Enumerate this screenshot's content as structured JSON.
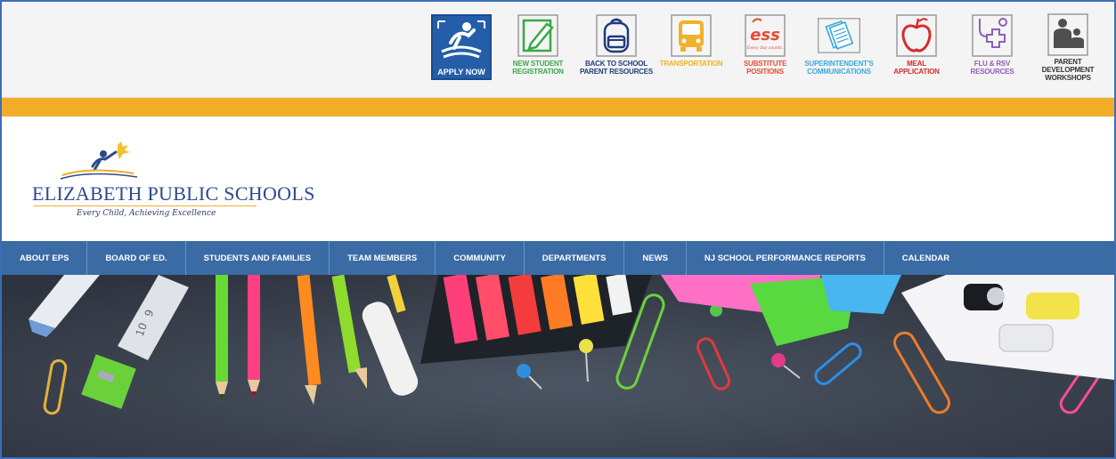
{
  "quick_links": [
    {
      "id": "apply",
      "label": "APPLY NOW",
      "icon": "student-reading-icon",
      "color": "#245ea8"
    },
    {
      "id": "registration",
      "label": "NEW STUDENT\nREGISTRATION",
      "icon": "pencil-form-icon",
      "color": "#39a846"
    },
    {
      "id": "back-to-school",
      "label": "BACK TO SCHOOL\nPARENT RESOURCES",
      "icon": "backpack-icon",
      "color": "#1f3b7a"
    },
    {
      "id": "transportation",
      "label": "TRANSPORTATION",
      "icon": "school-bus-icon",
      "color": "#f1b12a"
    },
    {
      "id": "substitute",
      "label": "SUBSTITUTE\nPOSITIONS",
      "icon": "ess-logo-icon",
      "color": "#e34c35",
      "badge": "ESS",
      "badge_sub": "Every day counts."
    },
    {
      "id": "superintendent",
      "label": "SUPERINTENDENT'S\nCOMMUNICATIONS",
      "icon": "documents-icon",
      "color": "#3aa9de"
    },
    {
      "id": "meal",
      "label": "MEAL\nAPPLICATION",
      "icon": "apple-icon",
      "color": "#d62c2c"
    },
    {
      "id": "flu",
      "label": "FLU & RSV\nRESOURCES",
      "icon": "stethoscope-cross-icon",
      "color": "#8d5fb8"
    },
    {
      "id": "parent-dev",
      "label": "PARENT DEVELOPMENT\nWORKSHOPS",
      "icon": "parent-child-icon",
      "color": "#4f4f4f"
    }
  ],
  "logo": {
    "name": "ELIZABETH PUBLIC SCHOOLS",
    "tagline": "Every Child, Achieving Excellence"
  },
  "nav": [
    "ABOUT EPS",
    "BOARD OF ED.",
    "STUDENTS AND FAMILIES",
    "TEAM MEMBERS",
    "COMMUNITY",
    "DEPARTMENTS",
    "NEWS",
    "NJ SCHOOL PERFORMANCE REPORTS",
    "CALENDAR"
  ],
  "colors": {
    "accent_orange": "#f2ad28",
    "nav_blue": "#3a6ba5",
    "brand_navy": "#2b4b8c",
    "border_blue": "#3d6eb6"
  }
}
